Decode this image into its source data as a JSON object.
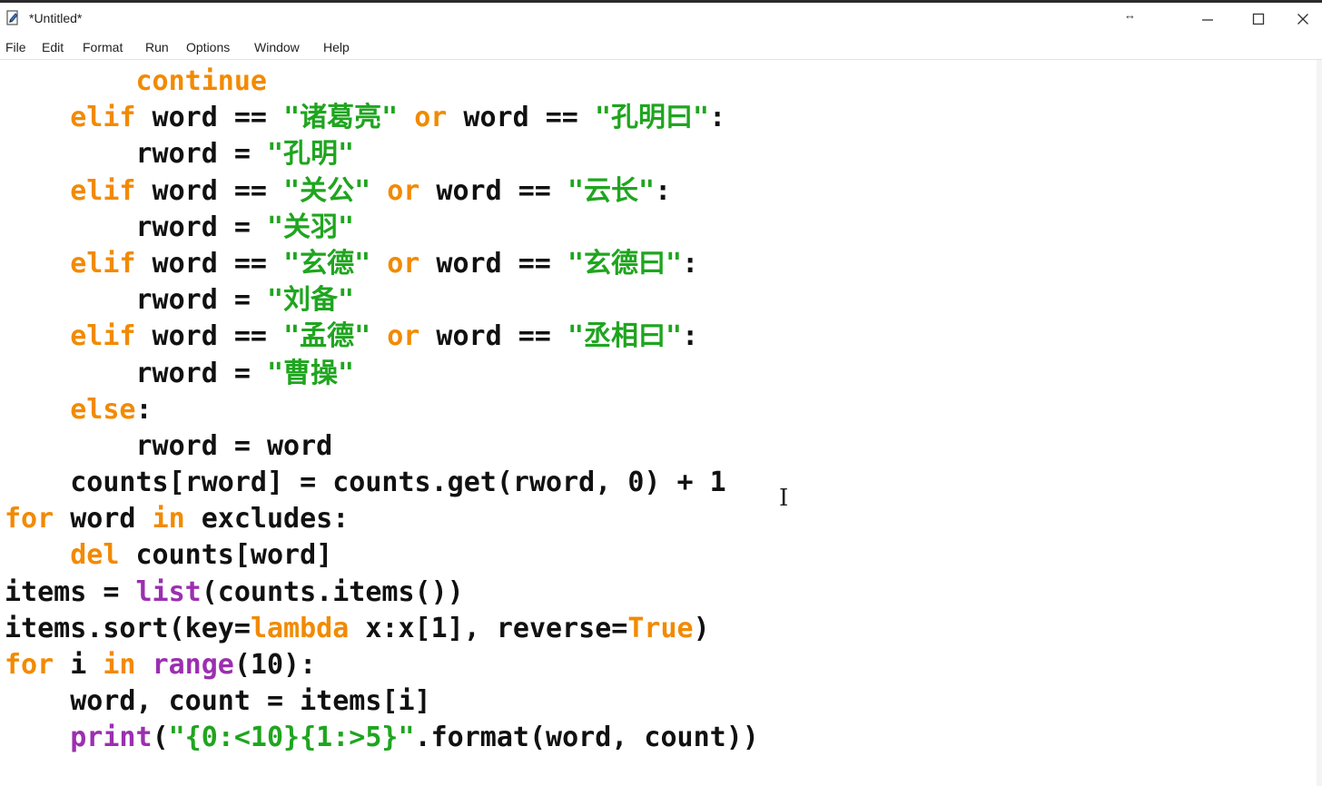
{
  "window": {
    "title": "*Untitled*",
    "pin_glyph": "↔"
  },
  "menu": {
    "items": [
      "File",
      "Edit",
      "Format",
      "Run",
      "Options",
      "Window",
      "Help"
    ]
  },
  "icons": {
    "app": "idle-file-icon",
    "minimize": "minimize-icon",
    "maximize": "maximize-icon",
    "close": "close-icon",
    "cursor": "text-cursor-icon"
  },
  "colors": {
    "keyword": "#f28a00",
    "string": "#1fa51f",
    "builtin": "#9b2fb0",
    "text": "#111111"
  },
  "code": {
    "lines": [
      [
        {
          "t": "        "
        },
        {
          "t": "continue",
          "c": "kw"
        }
      ],
      [
        {
          "t": "    "
        },
        {
          "t": "elif",
          "c": "kw"
        },
        {
          "t": " word == "
        },
        {
          "t": "\"诸葛亮\"",
          "c": "str"
        },
        {
          "t": " "
        },
        {
          "t": "or",
          "c": "kw"
        },
        {
          "t": " word == "
        },
        {
          "t": "\"孔明曰\"",
          "c": "str"
        },
        {
          "t": ":"
        }
      ],
      [
        {
          "t": "        rword = "
        },
        {
          "t": "\"孔明\"",
          "c": "str"
        }
      ],
      [
        {
          "t": "    "
        },
        {
          "t": "elif",
          "c": "kw"
        },
        {
          "t": " word == "
        },
        {
          "t": "\"关公\"",
          "c": "str"
        },
        {
          "t": " "
        },
        {
          "t": "or",
          "c": "kw"
        },
        {
          "t": " word == "
        },
        {
          "t": "\"云长\"",
          "c": "str"
        },
        {
          "t": ":"
        }
      ],
      [
        {
          "t": "        rword = "
        },
        {
          "t": "\"关羽\"",
          "c": "str"
        }
      ],
      [
        {
          "t": "    "
        },
        {
          "t": "elif",
          "c": "kw"
        },
        {
          "t": " word == "
        },
        {
          "t": "\"玄德\"",
          "c": "str"
        },
        {
          "t": " "
        },
        {
          "t": "or",
          "c": "kw"
        },
        {
          "t": " word == "
        },
        {
          "t": "\"玄德曰\"",
          "c": "str"
        },
        {
          "t": ":"
        }
      ],
      [
        {
          "t": "        rword = "
        },
        {
          "t": "\"刘备\"",
          "c": "str"
        }
      ],
      [
        {
          "t": "    "
        },
        {
          "t": "elif",
          "c": "kw"
        },
        {
          "t": " word == "
        },
        {
          "t": "\"孟德\"",
          "c": "str"
        },
        {
          "t": " "
        },
        {
          "t": "or",
          "c": "kw"
        },
        {
          "t": " word == "
        },
        {
          "t": "\"丞相曰\"",
          "c": "str"
        },
        {
          "t": ":"
        }
      ],
      [
        {
          "t": "        rword = "
        },
        {
          "t": "\"曹操\"",
          "c": "str"
        }
      ],
      [
        {
          "t": "    "
        },
        {
          "t": "else",
          "c": "kw"
        },
        {
          "t": ":"
        }
      ],
      [
        {
          "t": "        rword = word"
        }
      ],
      [
        {
          "t": "    counts[rword] = counts.get(rword, 0) + 1"
        }
      ],
      [
        {
          "t": "for",
          "c": "kw"
        },
        {
          "t": " word "
        },
        {
          "t": "in",
          "c": "kw"
        },
        {
          "t": " excludes:"
        }
      ],
      [
        {
          "t": "    "
        },
        {
          "t": "del",
          "c": "kw"
        },
        {
          "t": " counts[word]"
        }
      ],
      [
        {
          "t": "items = "
        },
        {
          "t": "list",
          "c": "bi"
        },
        {
          "t": "(counts.items())"
        }
      ],
      [
        {
          "t": "items.sort(key="
        },
        {
          "t": "lambda",
          "c": "kw"
        },
        {
          "t": " x:x[1], reverse="
        },
        {
          "t": "True",
          "c": "kw"
        },
        {
          "t": ")"
        }
      ],
      [
        {
          "t": "for",
          "c": "kw"
        },
        {
          "t": " i "
        },
        {
          "t": "in",
          "c": "kw"
        },
        {
          "t": " "
        },
        {
          "t": "range",
          "c": "bi"
        },
        {
          "t": "(10):"
        }
      ],
      [
        {
          "t": "    word, count = items[i]"
        }
      ],
      [
        {
          "t": "    "
        },
        {
          "t": "print",
          "c": "bi"
        },
        {
          "t": "("
        },
        {
          "t": "\"{0:<10}{1:>5}\"",
          "c": "str"
        },
        {
          "t": ".format(word, count))"
        }
      ]
    ]
  }
}
